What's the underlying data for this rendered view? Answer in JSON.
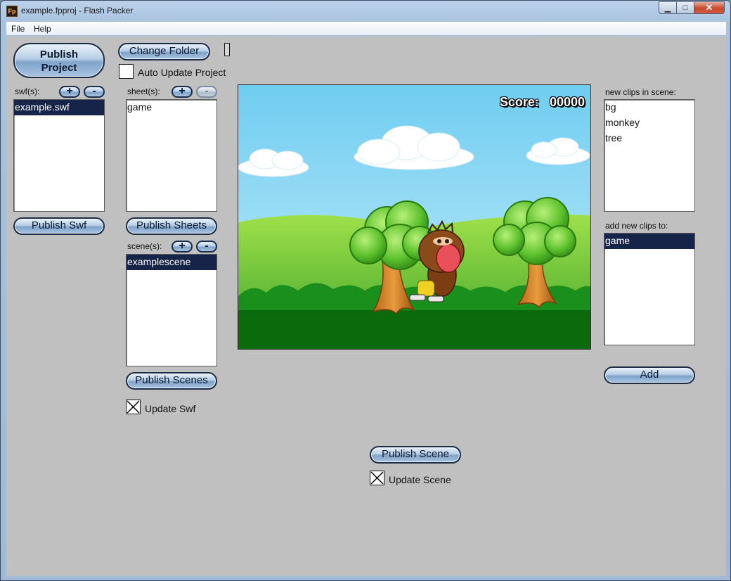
{
  "window": {
    "title": "example.fpproj - Flash Packer",
    "icon_text": "Fp",
    "controls": {
      "minimize": "▁",
      "maximize": "□",
      "close": "✕"
    }
  },
  "menu": {
    "items": [
      "File",
      "Help"
    ]
  },
  "toolbar": {
    "publish_project": "Publish\nProject",
    "change_folder": "Change Folder",
    "auto_update_project": "Auto Update Project"
  },
  "swf_panel": {
    "label": "swf(s):",
    "add": "+",
    "remove": "-",
    "items": [
      "example.swf"
    ],
    "selected_index": 0,
    "publish": "Publish Swf"
  },
  "sheet_panel": {
    "label": "sheet(s):",
    "add": "+",
    "remove": "-",
    "items": [
      "game"
    ],
    "publish": "Publish Sheets"
  },
  "scene_panel": {
    "label": "scene(s):",
    "add": "+",
    "remove": "-",
    "items": [
      "examplescene"
    ],
    "selected_index": 0,
    "publish": "Publish Scenes",
    "update_swf": "Update Swf",
    "update_swf_checked": true
  },
  "preview": {
    "score_label": "Score:",
    "score_value": "00000"
  },
  "scene_actions": {
    "publish_scene": "Publish Scene",
    "update_scene": "Update Scene",
    "update_scene_checked": true
  },
  "clips_panel": {
    "new_clips_label": "new clips in scene:",
    "new_clips": [
      "bg",
      "monkey",
      "tree"
    ],
    "add_to_label": "add new clips to:",
    "targets": [
      "game"
    ],
    "selected_target": 0,
    "add_button": "Add"
  },
  "colors": {
    "client_bg": "#c0c0c0",
    "selection": "#17244a",
    "sky": "#7fd3ef",
    "grass": "#1f8a1f"
  }
}
